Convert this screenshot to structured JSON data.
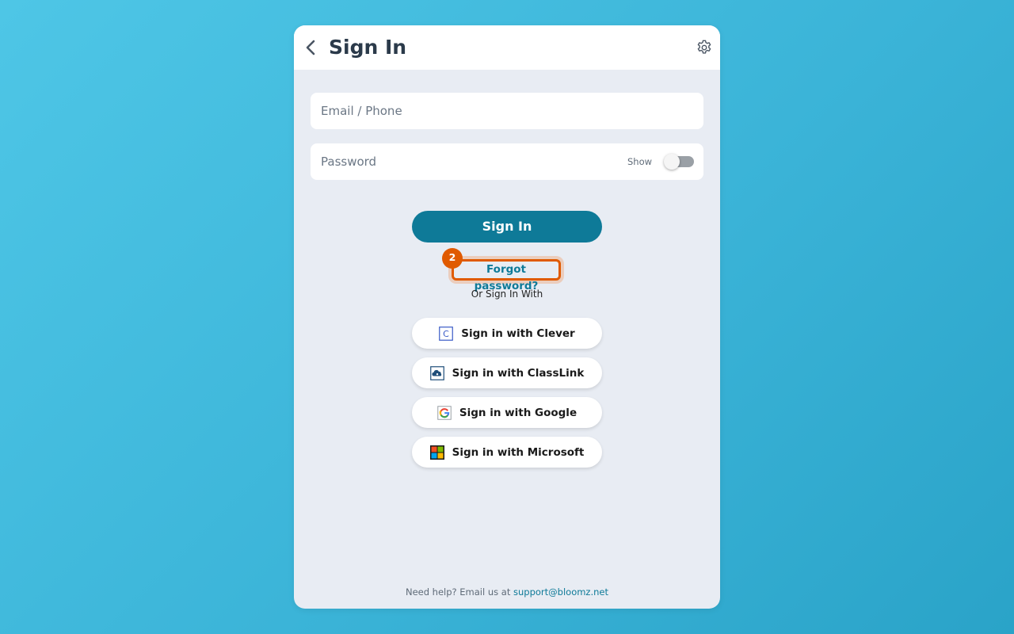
{
  "header": {
    "title": "Sign In"
  },
  "form": {
    "email_placeholder": "Email / Phone",
    "password_placeholder": "Password",
    "show_label": "Show",
    "show_password_on": false
  },
  "actions": {
    "signin_label": "Sign In",
    "forgot_label": "Forgot password?",
    "step_badge": "2",
    "or_label": "Or Sign In With"
  },
  "sso": [
    {
      "label": "Sign in with Clever",
      "icon": "clever-icon"
    },
    {
      "label": "Sign in with ClassLink",
      "icon": "classlink-icon"
    },
    {
      "label": "Sign in with Google",
      "icon": "google-icon"
    },
    {
      "label": "Sign in with Microsoft",
      "icon": "microsoft-icon"
    }
  ],
  "footer": {
    "help_text": "Need help? Email us at",
    "help_email": "support@bloomz.net"
  },
  "colors": {
    "primary": "#0e7a98",
    "highlight": "#e05a00",
    "card_bg": "#e8ecf3",
    "background": "#3bb4d8"
  }
}
